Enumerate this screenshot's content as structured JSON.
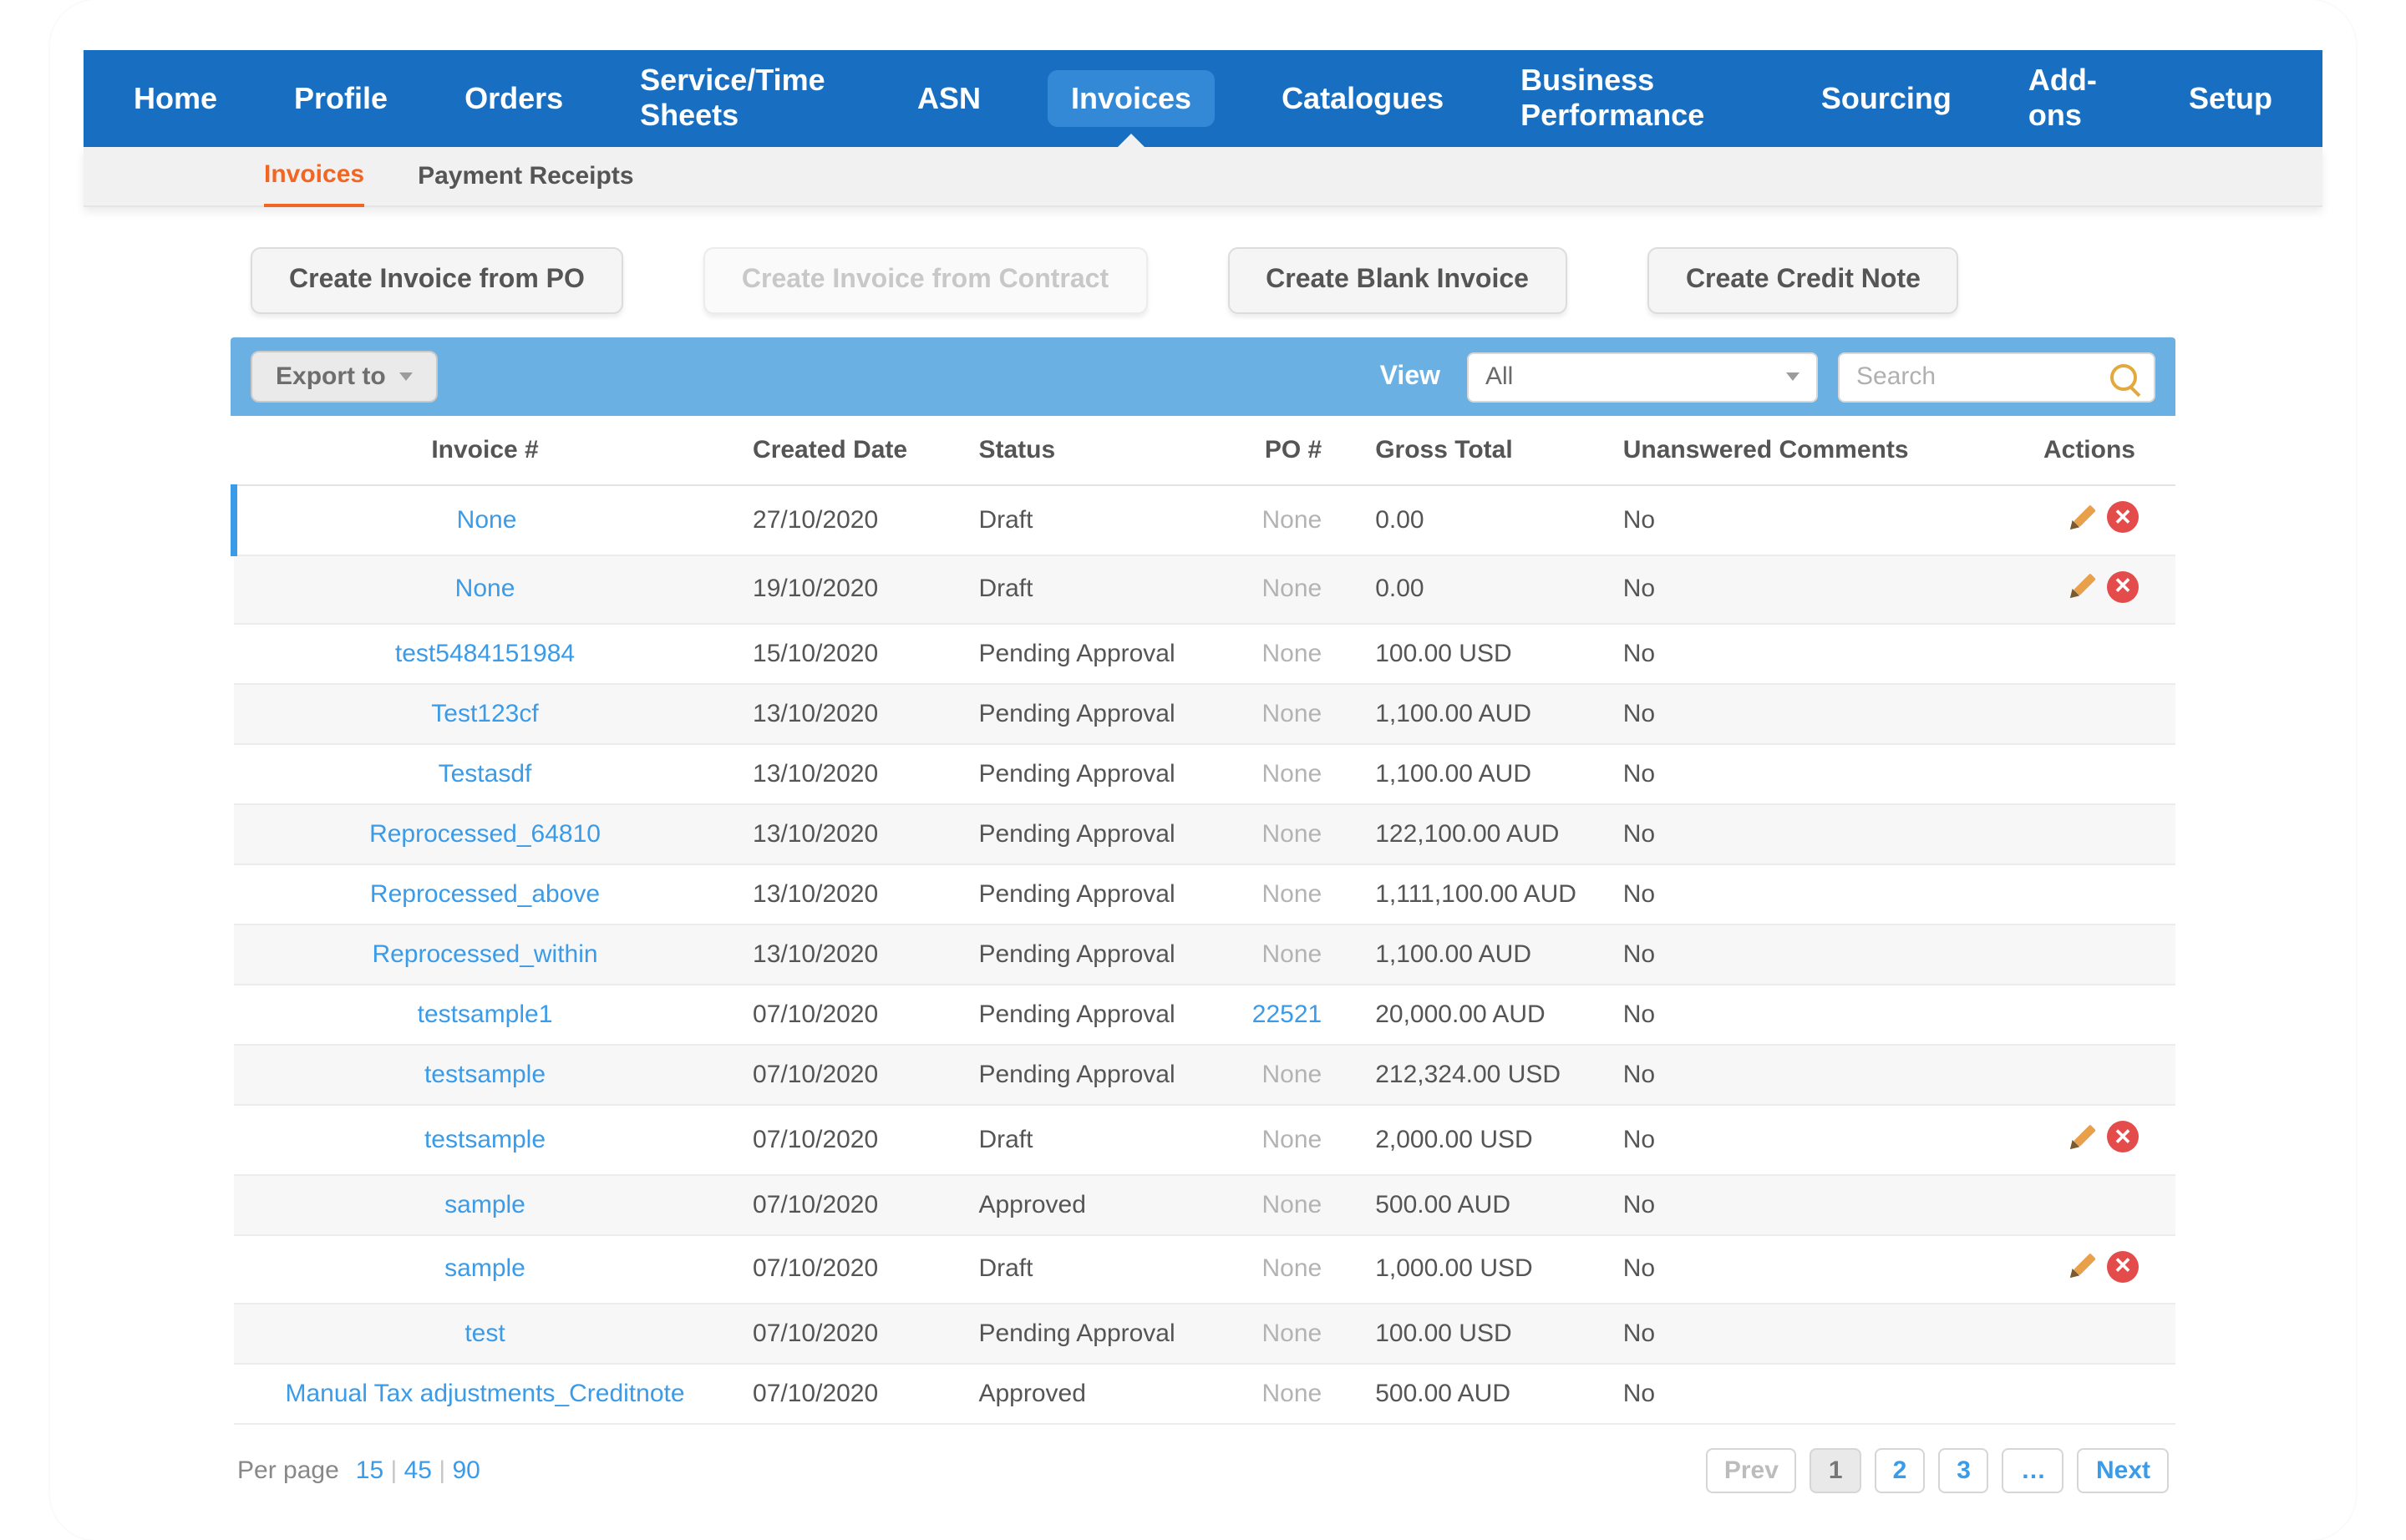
{
  "topnav": {
    "items": [
      {
        "label": "Home"
      },
      {
        "label": "Profile"
      },
      {
        "label": "Orders"
      },
      {
        "label": "Service/Time Sheets"
      },
      {
        "label": "ASN"
      },
      {
        "label": "Invoices",
        "active": true
      },
      {
        "label": "Catalogues"
      },
      {
        "label": "Business Performance"
      },
      {
        "label": "Sourcing"
      },
      {
        "label": "Add-ons"
      },
      {
        "label": "Setup"
      }
    ]
  },
  "subtabs": {
    "items": [
      {
        "label": "Invoices",
        "active": true
      },
      {
        "label": "Payment Receipts"
      }
    ]
  },
  "actions": {
    "create_from_po": "Create Invoice from PO",
    "create_from_contract": "Create Invoice from Contract",
    "create_blank": "Create Blank Invoice",
    "create_credit_note": "Create Credit Note"
  },
  "toolbar": {
    "export_label": "Export to",
    "view_label": "View",
    "view_selected": "All",
    "search_placeholder": "Search"
  },
  "table": {
    "headers": {
      "invoice": "Invoice #",
      "created": "Created Date",
      "status": "Status",
      "po": "PO #",
      "gross": "Gross Total",
      "comments": "Unanswered Comments",
      "actions": "Actions"
    },
    "rows": [
      {
        "invoice": "None",
        "created": "27/10/2020",
        "status": "Draft",
        "po": "None",
        "po_link": false,
        "gross": "0.00",
        "comments": "No",
        "editable": true,
        "highlight": true
      },
      {
        "invoice": "None",
        "created": "19/10/2020",
        "status": "Draft",
        "po": "None",
        "po_link": false,
        "gross": "0.00",
        "comments": "No",
        "editable": true
      },
      {
        "invoice": "test5484151984",
        "created": "15/10/2020",
        "status": "Pending Approval",
        "po": "None",
        "po_link": false,
        "gross": "100.00 USD",
        "comments": "No",
        "editable": false
      },
      {
        "invoice": "Test123cf",
        "created": "13/10/2020",
        "status": "Pending Approval",
        "po": "None",
        "po_link": false,
        "gross": "1,100.00 AUD",
        "comments": "No",
        "editable": false
      },
      {
        "invoice": "Testasdf",
        "created": "13/10/2020",
        "status": "Pending Approval",
        "po": "None",
        "po_link": false,
        "gross": "1,100.00 AUD",
        "comments": "No",
        "editable": false
      },
      {
        "invoice": "Reprocessed_64810",
        "created": "13/10/2020",
        "status": "Pending Approval",
        "po": "None",
        "po_link": false,
        "gross": "122,100.00 AUD",
        "comments": "No",
        "editable": false
      },
      {
        "invoice": "Reprocessed_above",
        "created": "13/10/2020",
        "status": "Pending Approval",
        "po": "None",
        "po_link": false,
        "gross": "1,111,100.00 AUD",
        "comments": "No",
        "editable": false
      },
      {
        "invoice": "Reprocessed_within",
        "created": "13/10/2020",
        "status": "Pending Approval",
        "po": "None",
        "po_link": false,
        "gross": "1,100.00 AUD",
        "comments": "No",
        "editable": false
      },
      {
        "invoice": "testsample1",
        "created": "07/10/2020",
        "status": "Pending Approval",
        "po": "22521",
        "po_link": true,
        "gross": "20,000.00 AUD",
        "comments": "No",
        "editable": false
      },
      {
        "invoice": "testsample",
        "created": "07/10/2020",
        "status": "Pending Approval",
        "po": "None",
        "po_link": false,
        "gross": "212,324.00 USD",
        "comments": "No",
        "editable": false
      },
      {
        "invoice": "testsample",
        "created": "07/10/2020",
        "status": "Draft",
        "po": "None",
        "po_link": false,
        "gross": "2,000.00 USD",
        "comments": "No",
        "editable": true
      },
      {
        "invoice": "sample",
        "created": "07/10/2020",
        "status": "Approved",
        "po": "None",
        "po_link": false,
        "gross": "500.00 AUD",
        "comments": "No",
        "editable": false
      },
      {
        "invoice": "sample",
        "created": "07/10/2020",
        "status": "Draft",
        "po": "None",
        "po_link": false,
        "gross": "1,000.00 USD",
        "comments": "No",
        "editable": true
      },
      {
        "invoice": "test",
        "created": "07/10/2020",
        "status": "Pending Approval",
        "po": "None",
        "po_link": false,
        "gross": "100.00 USD",
        "comments": "No",
        "editable": false
      },
      {
        "invoice": "Manual Tax adjustments_Creditnote",
        "created": "07/10/2020",
        "status": "Approved",
        "po": "None",
        "po_link": false,
        "gross": "500.00 AUD",
        "comments": "No",
        "editable": false
      }
    ]
  },
  "footer": {
    "perpage_label": "Per page",
    "perpage_options": [
      "15",
      "45",
      "90"
    ],
    "pager": {
      "prev": "Prev",
      "pages": [
        "1",
        "2",
        "3",
        "…"
      ],
      "next": "Next",
      "current": "1"
    }
  }
}
